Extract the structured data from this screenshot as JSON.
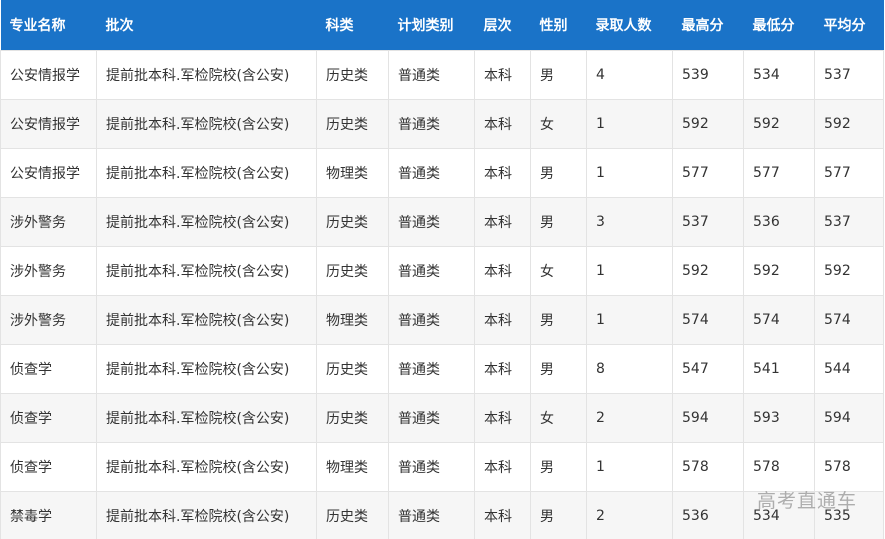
{
  "table": {
    "headers": [
      "专业名称",
      "批次",
      "科类",
      "计划类别",
      "层次",
      "性别",
      "录取人数",
      "最高分",
      "最低分",
      "平均分"
    ],
    "rows": [
      [
        "公安情报学",
        "提前批本科.军检院校(含公安)",
        "历史类",
        "普通类",
        "本科",
        "男",
        "4",
        "539",
        "534",
        "537"
      ],
      [
        "公安情报学",
        "提前批本科.军检院校(含公安)",
        "历史类",
        "普通类",
        "本科",
        "女",
        "1",
        "592",
        "592",
        "592"
      ],
      [
        "公安情报学",
        "提前批本科.军检院校(含公安)",
        "物理类",
        "普通类",
        "本科",
        "男",
        "1",
        "577",
        "577",
        "577"
      ],
      [
        "涉外警务",
        "提前批本科.军检院校(含公安)",
        "历史类",
        "普通类",
        "本科",
        "男",
        "3",
        "537",
        "536",
        "537"
      ],
      [
        "涉外警务",
        "提前批本科.军检院校(含公安)",
        "历史类",
        "普通类",
        "本科",
        "女",
        "1",
        "592",
        "592",
        "592"
      ],
      [
        "涉外警务",
        "提前批本科.军检院校(含公安)",
        "物理类",
        "普通类",
        "本科",
        "男",
        "1",
        "574",
        "574",
        "574"
      ],
      [
        "侦查学",
        "提前批本科.军检院校(含公安)",
        "历史类",
        "普通类",
        "本科",
        "男",
        "8",
        "547",
        "541",
        "544"
      ],
      [
        "侦查学",
        "提前批本科.军检院校(含公安)",
        "历史类",
        "普通类",
        "本科",
        "女",
        "2",
        "594",
        "593",
        "594"
      ],
      [
        "侦查学",
        "提前批本科.军检院校(含公安)",
        "物理类",
        "普通类",
        "本科",
        "男",
        "1",
        "578",
        "578",
        "578"
      ],
      [
        "禁毒学",
        "提前批本科.军检院校(含公安)",
        "历史类",
        "普通类",
        "本科",
        "男",
        "2",
        "536",
        "534",
        "535"
      ]
    ]
  },
  "watermark": "高考直通车",
  "colors": {
    "header_bg": "#1a73c8",
    "header_text": "#ffffff",
    "row_alt_bg": "#f6f6f6",
    "cell_text": "#333333"
  }
}
